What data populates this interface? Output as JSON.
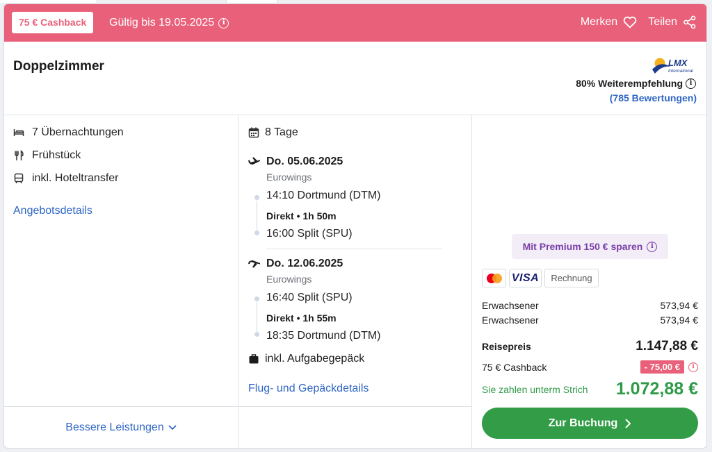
{
  "banner": {
    "cashback_badge": "75 € Cashback",
    "valid_until": "Gültig bis 19.05.2025",
    "save_label": "Merken",
    "share_label": "Teilen"
  },
  "offer": {
    "room_type": "Doppelzimmer",
    "operator_logo_text": "LMX International",
    "recommendation": "80% Weiterempfehlung",
    "reviews": "(785 Bewertungen)"
  },
  "features": {
    "nights": "7 Übernachtungen",
    "board": "Frühstück",
    "transfer": "inkl. Hoteltransfer",
    "details_link": "Angebotsdetails"
  },
  "flights": {
    "duration": "8 Tage",
    "outbound": {
      "date": "Do. 05.06.2025",
      "airline": "Eurowings",
      "departure": "14:10 Dortmund (DTM)",
      "info": "Direkt • 1h 50m",
      "arrival": "16:00 Split (SPU)"
    },
    "inbound": {
      "date": "Do. 12.06.2025",
      "airline": "Eurowings",
      "departure": "16:40 Split (SPU)",
      "info": "Direkt • 1h 55m",
      "arrival": "18:35 Dortmund (DTM)"
    },
    "baggage": "inkl. Aufgabegepäck",
    "details_link": "Flug- und Gepäckdetails"
  },
  "pricing": {
    "premium": "Mit Premium 150 € sparen",
    "payment": {
      "visa": "VISA",
      "invoice": "Rechnung"
    },
    "rows": [
      {
        "label": "Erwachsener",
        "value": "573,94 €"
      },
      {
        "label": "Erwachsener",
        "value": "573,94 €"
      }
    ],
    "total_label": "Reisepreis",
    "total_value": "1.147,88 €",
    "cashback_label": "75 € Cashback",
    "cashback_value": "- 75,00 €",
    "final_label": "Sie zahlen unterm Strich",
    "final_value": "1.072,88 €",
    "book_button": "Zur Buchung"
  },
  "footer": {
    "more_link": "Bessere Leistungen"
  },
  "colors": {
    "banner": "#e9607a",
    "link": "#2f66c4",
    "green": "#329d46",
    "premium_text": "#7a3ea7"
  }
}
